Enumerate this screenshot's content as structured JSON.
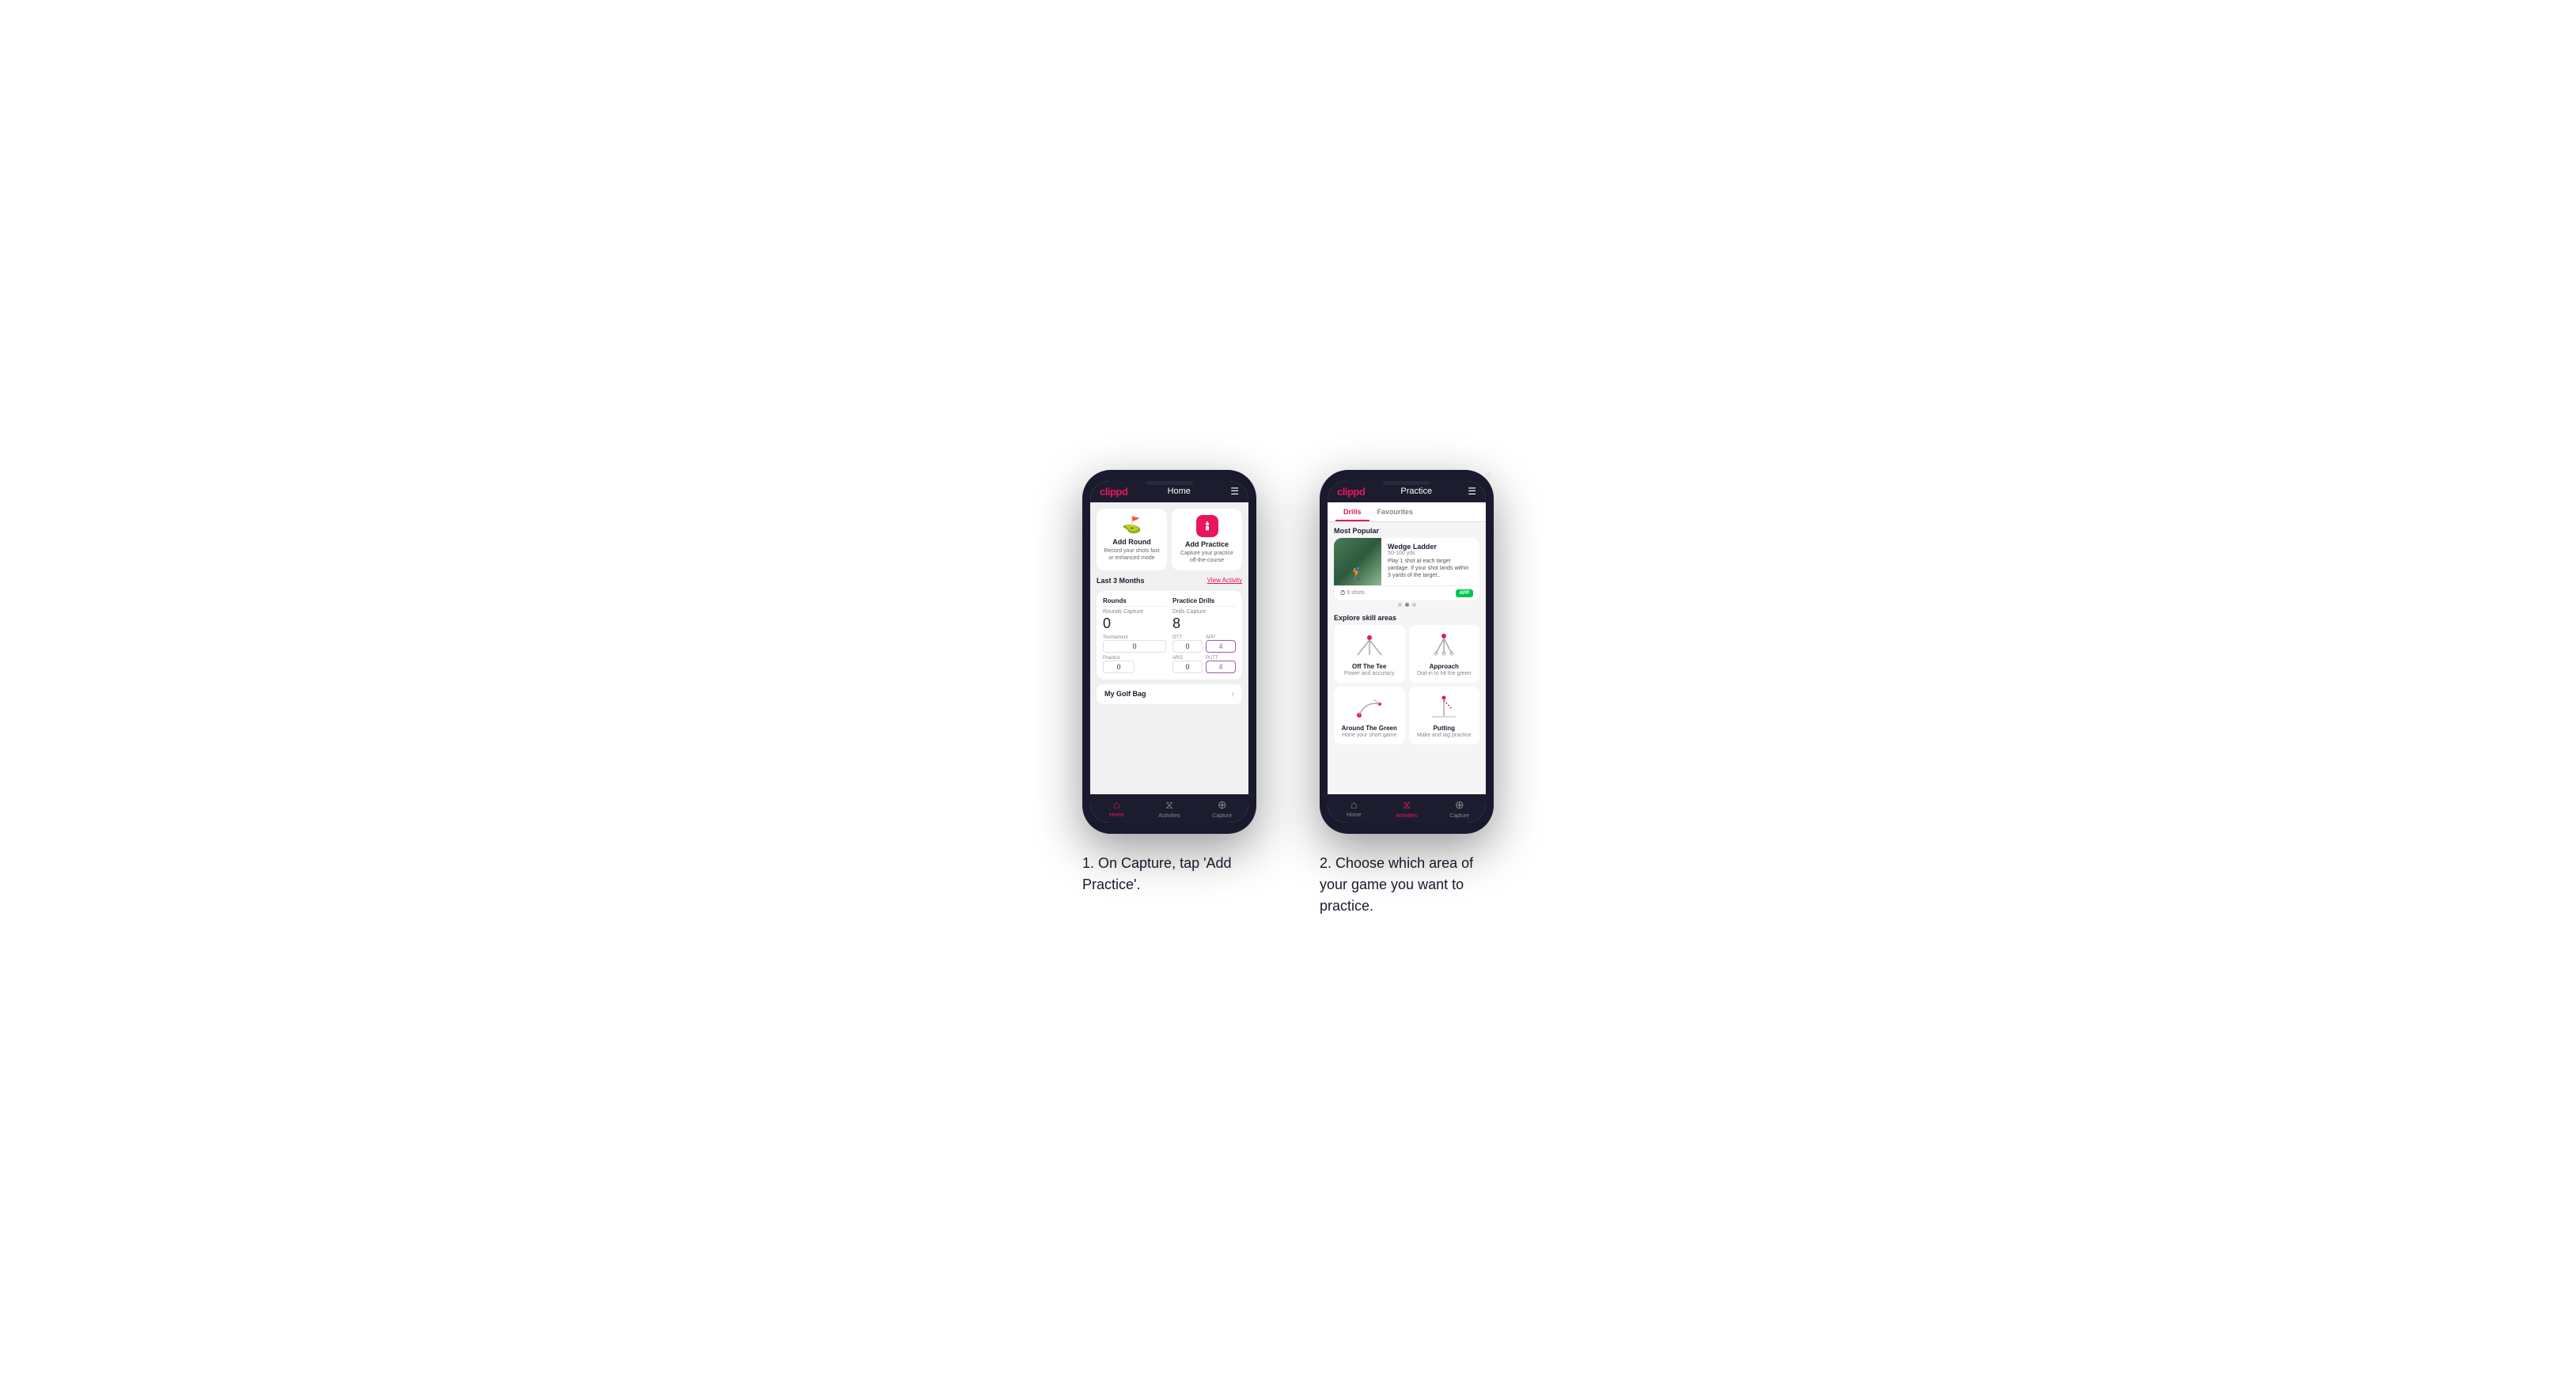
{
  "phone1": {
    "logo": "clippd",
    "header_title": "Home",
    "add_round": {
      "title": "Add Round",
      "desc": "Record your shots fast or enhanced mode"
    },
    "add_practice": {
      "title": "Add Practice",
      "desc": "Capture your practice off-the-course"
    },
    "last_months": "Last 3 Months",
    "view_activity": "View Activity",
    "rounds_title": "Rounds",
    "rounds_capture_label": "Rounds Capture",
    "rounds_value": "0",
    "tournament_label": "Tournament",
    "tournament_value": "0",
    "practice_label": "Practice",
    "practice_value": "0",
    "drills_title": "Practice Drills",
    "drills_capture_label": "Drills Capture",
    "drills_value": "8",
    "ott_label": "OTT",
    "ott_value": "0",
    "app_label": "APP",
    "app_value": "4",
    "arg_label": "ARG",
    "arg_value": "0",
    "putt_label": "PUTT",
    "putt_value": "4",
    "golf_bag": "My Golf Bag",
    "nav": {
      "home": "Home",
      "activities": "Activities",
      "capture": "Capture"
    }
  },
  "phone2": {
    "logo": "clippd",
    "header_title": "Practice",
    "tab_drills": "Drills",
    "tab_favourites": "Favourites",
    "most_popular": "Most Popular",
    "featured": {
      "title": "Wedge Ladder",
      "range": "50-100 yds",
      "description": "Play 1 shot at each target yardage. If your shot lands within 3 yards of the target..",
      "shots": "9 shots",
      "badge": "APP"
    },
    "explore_title": "Explore skill areas",
    "skills": [
      {
        "title": "Off The Tee",
        "desc": "Power and accuracy",
        "icon_type": "off_tee"
      },
      {
        "title": "Approach",
        "desc": "Dial-in to hit the green",
        "icon_type": "approach"
      },
      {
        "title": "Around The Green",
        "desc": "Hone your short game",
        "icon_type": "around_green"
      },
      {
        "title": "Putting",
        "desc": "Make and lag practice",
        "icon_type": "putting"
      }
    ],
    "nav": {
      "home": "Home",
      "activities": "Activities",
      "capture": "Capture"
    }
  },
  "caption1": "1. On Capture, tap 'Add Practice'.",
  "caption2": "2. Choose which area of your game you want to practice."
}
